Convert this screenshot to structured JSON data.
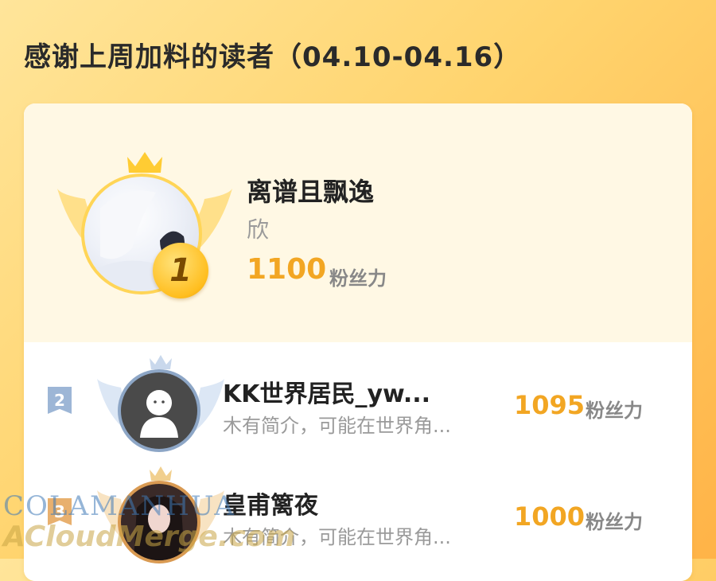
{
  "title": "感谢上周加料的读者（04.10-04.16）",
  "ranking": [
    {
      "rank": "1",
      "name": "离谱且飘逸",
      "bio": "欣",
      "score": "1100",
      "unit": "粉丝力"
    },
    {
      "rank": "2",
      "name": "KK世界居民_yw...",
      "bio": "木有简介，可能在世界角...",
      "score": "1095",
      "unit": "粉丝力"
    },
    {
      "rank": "3",
      "name": "皇甫篱夜",
      "bio": "木有简介，可能在世界角...",
      "score": "1000",
      "unit": "粉丝力"
    }
  ],
  "watermark": {
    "line1": "COLAMANHUA",
    "line2": "ACloudMerge.com"
  },
  "colors": {
    "accent": "#f2a623",
    "gold": "#ffd557",
    "silver": "#8da6c6",
    "bronze": "#d99a52"
  }
}
